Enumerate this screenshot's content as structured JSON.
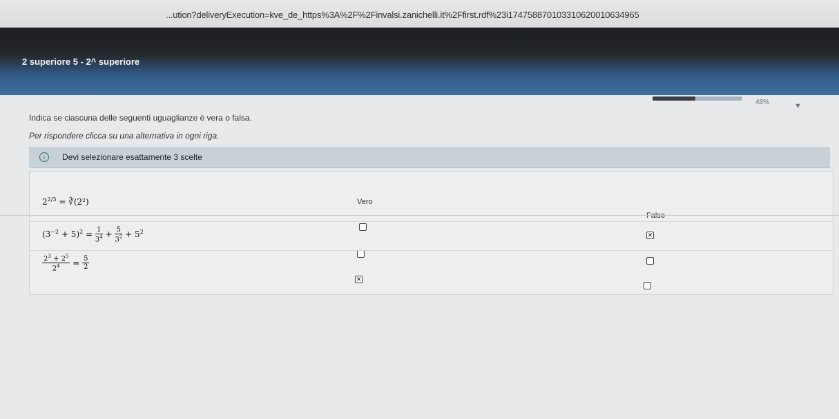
{
  "browser": {
    "url": "...ution?deliveryExecution=kve_de_https%3A%2F%2Finvalsi.zanichelli.it%2Ffirst.rdf%23i1747588701033106200106349​65"
  },
  "app": {
    "title": "2 superiore 5 - 2^ superiore",
    "progress_percent": 48,
    "progress_label": "48%"
  },
  "question": {
    "instruction": "Indica se ciascuna delle seguenti uguaglianze è vera o falsa.",
    "hint": "Per rispondere clicca su una alternativa in ogni riga.",
    "banner": "Devi selezionare esattamente 3 scelte"
  },
  "table": {
    "col_true": "Vero",
    "col_false": "Falso",
    "rows": [
      {
        "true_checked": false,
        "false_checked": true
      },
      {
        "true_checked": false,
        "false_checked": false
      },
      {
        "true_checked": true,
        "false_checked": false
      }
    ]
  },
  "colors": {
    "header_blue": "#3e6e9e",
    "banner": "#c7d1d7"
  }
}
